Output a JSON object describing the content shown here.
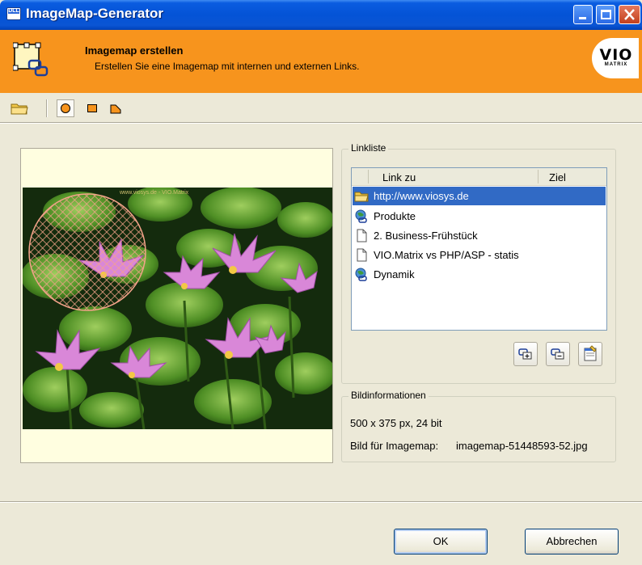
{
  "window": {
    "title": "ImageMap-Generator",
    "icon_label": "DLL",
    "minimize_icon": "minimize-icon",
    "maximize_icon": "maximize-icon",
    "close_icon": "close-icon"
  },
  "header": {
    "title": "Imagemap erstellen",
    "subtitle": "Erstellen Sie eine Imagemap mit internen und externen Links.",
    "logo_text": "VIO",
    "logo_subtext": "MATRIX",
    "accent_color": "#f7941d"
  },
  "toolbar": {
    "tools": [
      {
        "name": "open-folder",
        "icon": "folder-icon"
      },
      {
        "name": "circle-tool",
        "icon": "circle-icon",
        "active": true
      },
      {
        "name": "rectangle-tool",
        "icon": "rectangle-icon"
      },
      {
        "name": "polygon-tool",
        "icon": "polygon-icon"
      }
    ]
  },
  "preview": {
    "image_label": "imagemap-51448593-52.jpg",
    "photo_caption": "www.viosys.de - VIO.Matrix"
  },
  "linkliste": {
    "title": "Linkliste",
    "columns": [
      "Link zu",
      "Ziel"
    ],
    "rows": [
      {
        "label": "http://www.viosys.de",
        "icon": "folder-icon",
        "selected": true
      },
      {
        "label": "Produkte",
        "icon": "globe-link-icon",
        "selected": false
      },
      {
        "label": "2. Business-Frühstück",
        "icon": "document-icon",
        "selected": false
      },
      {
        "label": "VIO.Matrix vs PHP/ASP - statis",
        "icon": "document-icon",
        "selected": false
      },
      {
        "label": "Dynamik",
        "icon": "globe-link-icon",
        "selected": false
      }
    ],
    "buttons": [
      {
        "name": "add-link",
        "icon": "link-add-icon"
      },
      {
        "name": "remove-link",
        "icon": "link-remove-icon"
      },
      {
        "name": "edit-link",
        "icon": "properties-icon"
      }
    ]
  },
  "bildinfo": {
    "title": "Bildinformationen",
    "dimensions": "500 x 375 px, 24 bit",
    "image_label": "Bild für Imagemap:",
    "image_file": "imagemap-51448593-52.jpg"
  },
  "buttons": {
    "ok": "OK",
    "cancel": "Abbrechen"
  }
}
